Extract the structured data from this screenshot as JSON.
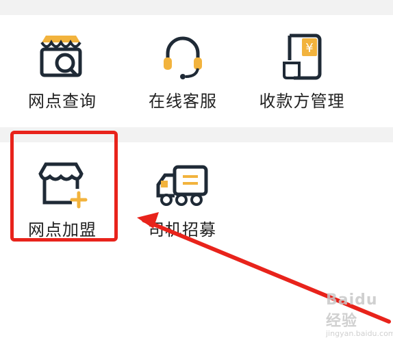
{
  "services_row1": [
    {
      "label": "网点查询",
      "icon": "store-search-icon"
    },
    {
      "label": "在线客服",
      "icon": "headset-icon"
    },
    {
      "label": "收款方管理",
      "icon": "payee-document-icon"
    }
  ],
  "services_row2": [
    {
      "label": "网点加盟",
      "icon": "store-plus-icon"
    },
    {
      "label": "司机招募",
      "icon": "truck-icon"
    }
  ],
  "annotation": {
    "highlight_color": "#e8231b",
    "arrow_color": "#e8231b"
  },
  "colors": {
    "icon_dark": "#1f2a36",
    "icon_accent": "#f2b33d",
    "label": "#222222"
  },
  "watermark": {
    "brand": "Baidu经验",
    "sub": "jingyan.baidu.com"
  }
}
